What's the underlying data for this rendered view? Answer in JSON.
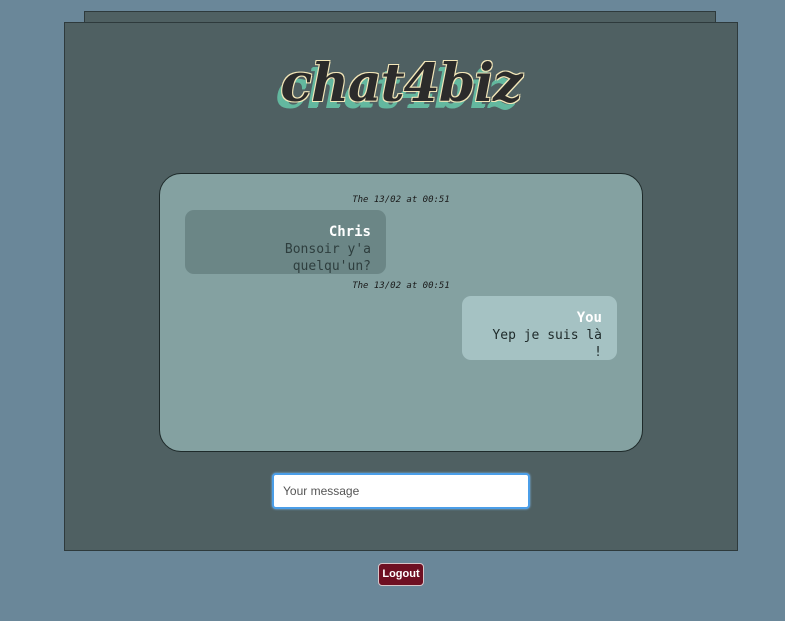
{
  "app": {
    "logo_text": "chat4biz"
  },
  "chat": {
    "messages": [
      {
        "timestamp": "The 13/02 at 00:51",
        "sender": "Chris",
        "text": "Bonsoir y'a quelqu'un?",
        "is_self": false
      },
      {
        "timestamp": "The 13/02 at 00:51",
        "sender": "You",
        "text": "Yep je suis là !",
        "is_self": true
      }
    ]
  },
  "composer": {
    "placeholder": "Your message",
    "value": ""
  },
  "actions": {
    "logout_label": "Logout"
  },
  "colors": {
    "page_background": "#6a8799",
    "panel_background": "#4f6062",
    "chat_background": "#84a1a1",
    "other_bubble": "#6b8686",
    "self_bubble": "#a5c2c3",
    "logout_button": "#6e0f22",
    "input_focus_border": "#4b9ee8"
  }
}
